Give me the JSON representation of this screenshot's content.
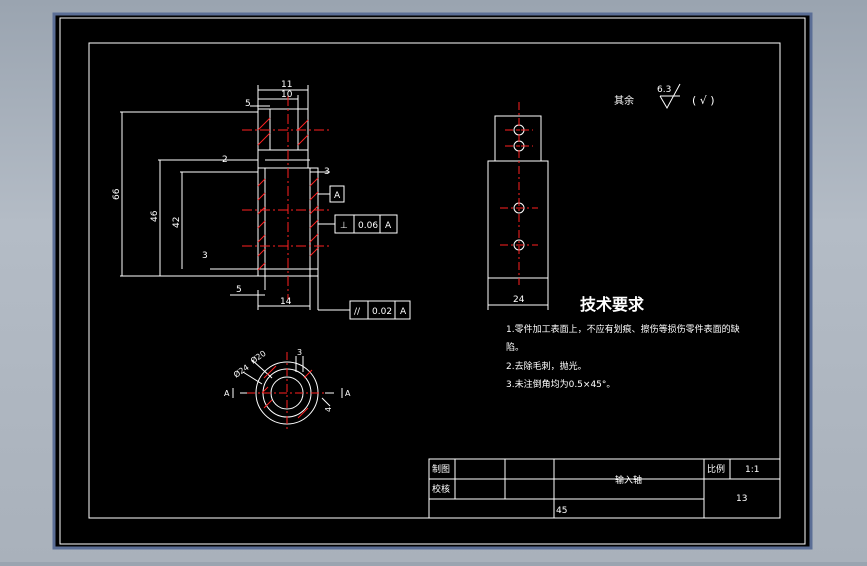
{
  "colors": {
    "canvas": "#000000",
    "line": "#ffffff",
    "center_line": "#ff2020",
    "hatch": "#ff2020",
    "frame_outer": "#5b6e96",
    "desktop": "#a6afba"
  },
  "front_view": {
    "dims": {
      "d11": "11",
      "d10": "10",
      "d5_top": "5",
      "d2": "2",
      "d3": "3",
      "d66": "66",
      "d46": "46",
      "d42": "42",
      "d3_left": "3",
      "d5_bottom": "5",
      "d14": "14"
    },
    "datum_label": "A",
    "perp_tolerance": {
      "symbol": "⊥",
      "value": "0.06",
      "datum": "A"
    },
    "parallel_tolerance": {
      "symbol": "//",
      "value": "0.02",
      "datum": "A"
    }
  },
  "section_view": {
    "d20": "Ø20",
    "d24": "Ø24",
    "d3": "3",
    "d4": "4",
    "section_label_left": "A",
    "section_label_right": "A"
  },
  "side_view": {
    "width_dim": "24"
  },
  "surface_finish": {
    "prefix": "其余",
    "value": "6.3",
    "suffix": "( √ )"
  },
  "tech_requirements": {
    "title": "技术要求",
    "items": [
      "1.零件加工表面上，不应有划痕、擦伤等损伤零件表面的缺",
      "陷。",
      "2.去除毛刺，抛光。",
      "3.未注倒角均为0.5×45°。"
    ]
  },
  "title_block": {
    "drawn_label": "制图",
    "checked_label": "校核",
    "part_name": "输入轴",
    "scale_label": "比例",
    "scale_value": "1:1",
    "drawing_no": "13",
    "material": "45"
  }
}
